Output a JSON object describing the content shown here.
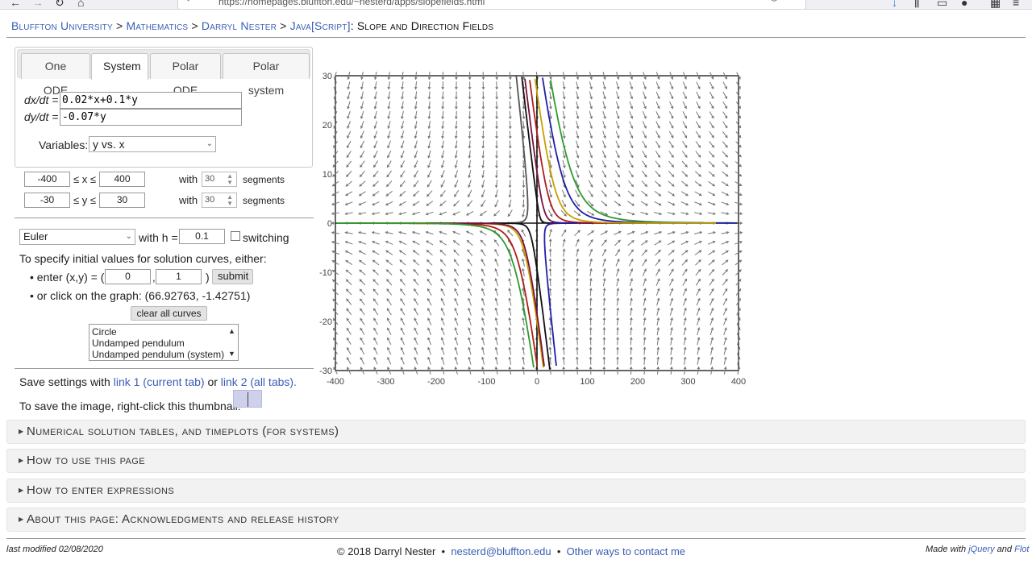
{
  "browser": {
    "url": "https://homepages.bluffton.edu/~nesterd/apps/slopefields.html",
    "icons": [
      "back-arrow-icon",
      "forward-arrow-icon",
      "reload-icon",
      "home-icon",
      "shield-icon",
      "lock-icon",
      "more-icon",
      "pocket-icon",
      "star-icon",
      "download-icon",
      "library-icon",
      "sidebar-icon",
      "account-icon",
      "extensions-icon",
      "menu-icon"
    ]
  },
  "breadcrumb": {
    "university": "Bluffton University",
    "dept": "Mathematics",
    "author": "Darryl Nester",
    "section": "Java[Script]",
    "page": "Slope and Direction Fields",
    "sep": ">"
  },
  "tabs": [
    {
      "label": "One ODE"
    },
    {
      "label": "System"
    },
    {
      "label": "Polar ODE"
    },
    {
      "label": "Polar system"
    }
  ],
  "system": {
    "dx_label": "dx/dt =",
    "dx_value": "0.02*x+0.1*y",
    "dy_label": "dy/dt =",
    "dy_value": "-0.07*y",
    "variables_label": "Variables:",
    "variables_value": "y vs. x"
  },
  "ranges": {
    "xmin": "-400",
    "xmax": "400",
    "xvar": "≤ x ≤",
    "ymin": "-30",
    "ymax": "30",
    "yvar": "≤ y ≤",
    "with_label": "with",
    "x_segments": "30",
    "y_segments": "30",
    "segments_label": "segments"
  },
  "method": {
    "value": "Euler",
    "with_h_label": "with h =",
    "h_value": "0.1",
    "switching_label": "switching"
  },
  "initial": {
    "intro": "To specify initial values for solution curves, either:",
    "enter_label": "• enter (x,y) = (",
    "x0": "0",
    "comma": ",",
    "y0": "1",
    "close": ")",
    "submit_label": "submit",
    "click_label": "• or click on the graph: (66.92763, -1.42751)",
    "clear_label": "clear all curves"
  },
  "presets": [
    "Circle",
    "Undamped pendulum",
    "Undamped pendulum (system)"
  ],
  "save": {
    "prefix": "Save settings with",
    "link1": "link 1 (current tab)",
    "or": "or",
    "link2": "link 2 (all tabs).",
    "image_text": "To save the image, right-click this thumbnail:"
  },
  "accordions": [
    {
      "label": "Numerical solution tables, and timeplots (for systems)"
    },
    {
      "label": "How to use this page"
    },
    {
      "label": "How to enter expressions"
    },
    {
      "label": "About this page: Acknowledgments and release history"
    }
  ],
  "footer": {
    "modified": "last modified 02/08/2020",
    "copyright": "© 2018 Darryl Nester",
    "bullet": "•",
    "email": "nesterd@bluffton.edu",
    "contact": "Other ways to contact me",
    "made_with": "Made with",
    "jquery": "jQuery",
    "and": "and",
    "flot": "Flot"
  },
  "plot": {
    "x_ticks": [
      -400,
      -300,
      -200,
      -100,
      0,
      100,
      200,
      300,
      400
    ],
    "y_ticks": [
      30,
      20,
      10,
      0,
      -10,
      -20,
      -30
    ],
    "xlim": [
      -400,
      400
    ],
    "ylim": [
      -30,
      30
    ],
    "field_color": "#777777",
    "curve_colors": [
      "#2e9b2e",
      "#1f1fa8",
      "#b01c1c",
      "#c8a000",
      "#101010",
      "#7a1040",
      "#555555"
    ]
  }
}
